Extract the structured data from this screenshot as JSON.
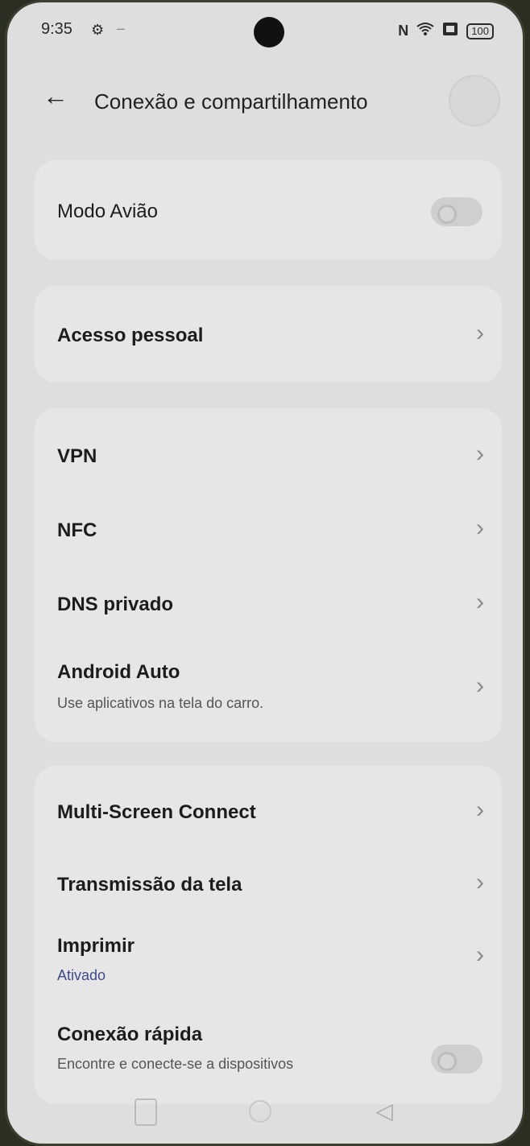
{
  "status_bar": {
    "time": "9:35",
    "battery": "100",
    "gear_icon": "gear-icon",
    "dash": "–",
    "nfc_icon": "N",
    "wifi_icon": "wifi-icon",
    "sim_icon": "sim-icon"
  },
  "header": {
    "back_icon": "←",
    "title": "Conexão e compartilhamento"
  },
  "cards": {
    "airplane": {
      "label": "Modo Avião",
      "toggle_on": false
    },
    "hotspot": {
      "label": "Acesso pessoal"
    },
    "vpn": {
      "label": "VPN"
    },
    "nfc": {
      "label": "NFC"
    },
    "dns": {
      "label": "DNS privado"
    },
    "android_auto": {
      "label": "Android Auto",
      "sub": "Use aplicativos na tela do carro."
    },
    "multiscreen": {
      "label": "Multi-Screen Connect"
    },
    "cast": {
      "label": "Transmissão da tela"
    },
    "print": {
      "label": "Imprimir",
      "sub": "Ativado"
    },
    "quick_connect": {
      "label": "Conexão rápida",
      "sub": "Encontre e conecte-se a dispositivos",
      "toggle_on": false
    }
  },
  "chevron": "›",
  "colors": {
    "accent_sub": "#3e4a8a",
    "background": "#dedede",
    "card": "#e6e6e6"
  }
}
